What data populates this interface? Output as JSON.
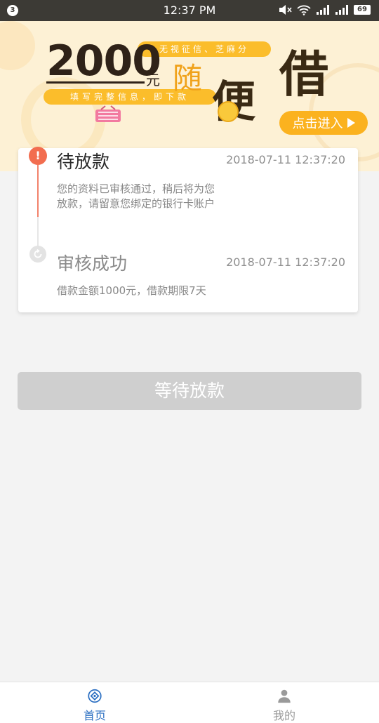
{
  "status_bar": {
    "notification_count": "3",
    "time": "12:37 PM",
    "battery": "69",
    "icons": [
      "mute-icon",
      "wifi-icon",
      "signal-icon",
      "signal-icon"
    ]
  },
  "banner": {
    "amount": "2000",
    "unit": "元",
    "pill_top": "无视征信、芝麻分",
    "pill_bottom": "填写完整信息，即下款",
    "slogan": [
      "随",
      "便",
      "借"
    ],
    "enter_label": "点击进入"
  },
  "timeline": {
    "items": [
      {
        "title": "待放款",
        "time": "2018-07-11 12:37:20",
        "desc": "您的资料已审核通过，稍后将为您放款，请留意您绑定的银行卡账户",
        "status_icon": "alert-icon",
        "status_glyph": "!"
      },
      {
        "title": "审核成功",
        "time": "2018-07-11 12:37:20",
        "desc": "借款金额1000元，借款期限7天",
        "status_icon": "refresh-icon"
      }
    ]
  },
  "action": {
    "wait_label": "等待放款"
  },
  "bottom_nav": {
    "items": [
      {
        "label": "首页",
        "icon": "home-icon",
        "active": true
      },
      {
        "label": "我的",
        "icon": "user-icon",
        "active": false
      }
    ]
  },
  "colors": {
    "accent_blue": "#2b6fc2",
    "alert_red": "#f26d4f",
    "banner_yellow": "#fbbd2b",
    "disabled_grey": "#cfcfcf"
  }
}
